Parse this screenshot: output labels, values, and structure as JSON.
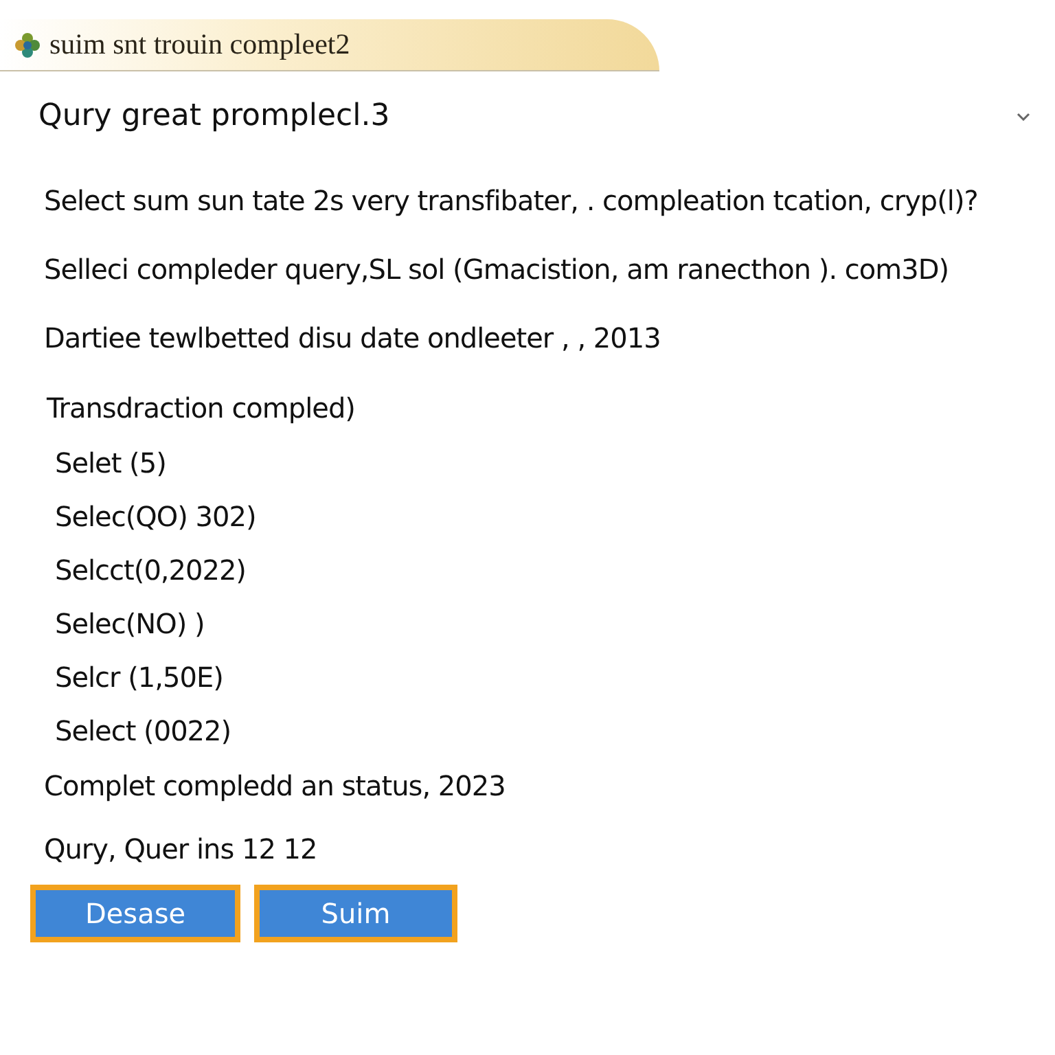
{
  "window": {
    "title": "suim snt trouin compleet2"
  },
  "heading": "Qury great promplecl.3",
  "paragraphs": [
    "Select sum sun tate 2s very transfibater, . compleation tcation, cryp(l)?",
    "Selleci compleder query,SL sol (Gmacistion, am ranecthon ). com3D)",
    "Dartiee tewlbetted disu date ondleeter , , 2013"
  ],
  "section_title": "Transdraction compled)",
  "items": [
    "Selet (5)",
    "Selec(QO) 302)",
    "Selcct(0,2022)",
    "Selec(NO) )",
    "Selcr (1,50E)",
    "Select (0022)"
  ],
  "status_lines": [
    "Complet compledd an status, 2023",
    "Qury, Quer ins 12 12"
  ],
  "buttons": [
    "Desase",
    "Suim"
  ]
}
